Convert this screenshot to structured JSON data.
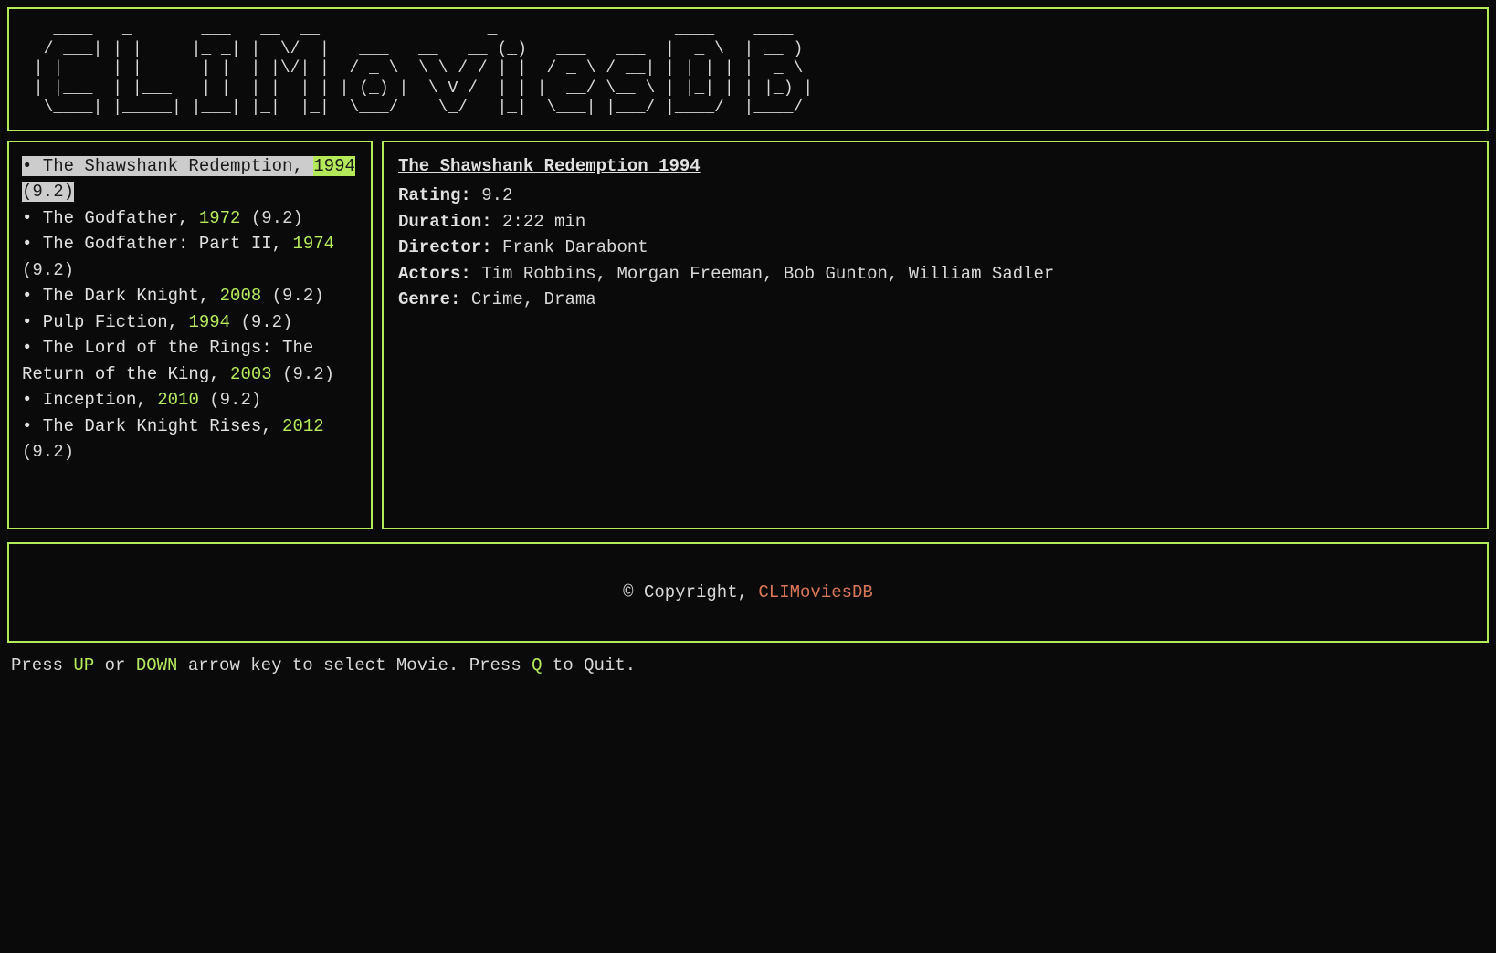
{
  "ascii_logo": "   ____   _       ___   __  __                 _                  ____    ____  \n  / ___| | |     |_ _| |  \\/  |   ___   __   __ (_)   ___   ___  |  _ \\  | __ ) \n | |     | |      | |  | |\\/| |  / _ \\  \\ \\ / / | |  / _ \\ / __| | | | | |  _ \\ \n | |___  | |___   | |  | |  | | | (_) |  \\ V /  | | |  __/ \\__ \\ | |_| | | |_) |\n  \\____| |_____| |___| |_|  |_|  \\___/    \\_/   |_|  \\___| |___/ |____/  |____/ ",
  "movies": [
    {
      "title": "The Shawshank Redemption",
      "year": "1994",
      "rating": "9.2",
      "selected": true
    },
    {
      "title": "The Godfather",
      "year": "1972",
      "rating": "9.2",
      "selected": false
    },
    {
      "title": "The Godfather: Part II",
      "year": "1974",
      "rating": "9.2",
      "selected": false
    },
    {
      "title": "The Dark Knight",
      "year": "2008",
      "rating": "9.2",
      "selected": false
    },
    {
      "title": "Pulp Fiction",
      "year": "1994",
      "rating": "9.2",
      "selected": false
    },
    {
      "title": "The Lord of the Rings: The Return of the King",
      "year": "2003",
      "rating": "9.2",
      "selected": false
    },
    {
      "title": "Inception",
      "year": "2010",
      "rating": "9.2",
      "selected": false
    },
    {
      "title": "The Dark Knight Rises",
      "year": "2012",
      "rating": "9.2",
      "selected": false
    }
  ],
  "detail": {
    "title": "The Shawshank Redemption 1994",
    "rating_label": "Rating:",
    "rating_value": "9.2",
    "duration_label": "Duration:",
    "duration_value": "2:22 min",
    "director_label": "Director:",
    "director_value": "Frank Darabont",
    "actors_label": "Actors:",
    "actors_value": "Tim Robbins, Morgan Freeman, Bob Gunton, William Sadler",
    "genre_label": "Genre:",
    "genre_value": "Crime, Drama"
  },
  "footer": {
    "copyright": "© Copyright, ",
    "brand": "CLIMoviesDB"
  },
  "hint": {
    "pre": "Press ",
    "key1": "UP",
    "mid1": " or ",
    "key2": "DOWN",
    "mid2": " arrow key to select Movie. Press ",
    "key3": "Q",
    "post": " to Quit."
  }
}
